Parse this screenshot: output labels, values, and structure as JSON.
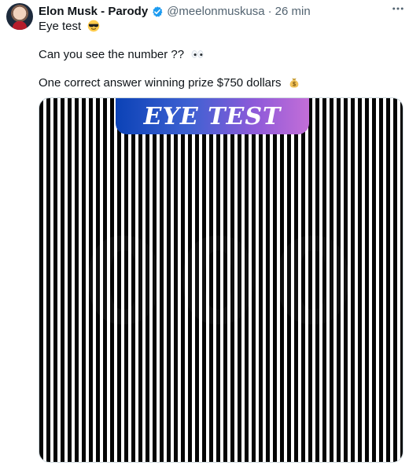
{
  "author": {
    "name": "Elon Musk - Parody",
    "handle": "@meelonmuskusa",
    "separator": "·",
    "time": "26 min"
  },
  "icons": {
    "verified": "verified-badge-icon",
    "more": "more-options-icon",
    "sunglasses": "sunglasses-emoji-icon",
    "eyes": "eyes-emoji-icon",
    "money_bag": "money-bag-emoji-icon"
  },
  "tweet": {
    "line1": "Eye test",
    "line2": "Can you see the number ??",
    "line3": "One correct answer winning prize $750 dollars"
  },
  "media": {
    "banner": "EYE TEST"
  },
  "colors": {
    "accent": "#1d9bf0",
    "text": "#0f1419",
    "muted": "#536471"
  }
}
